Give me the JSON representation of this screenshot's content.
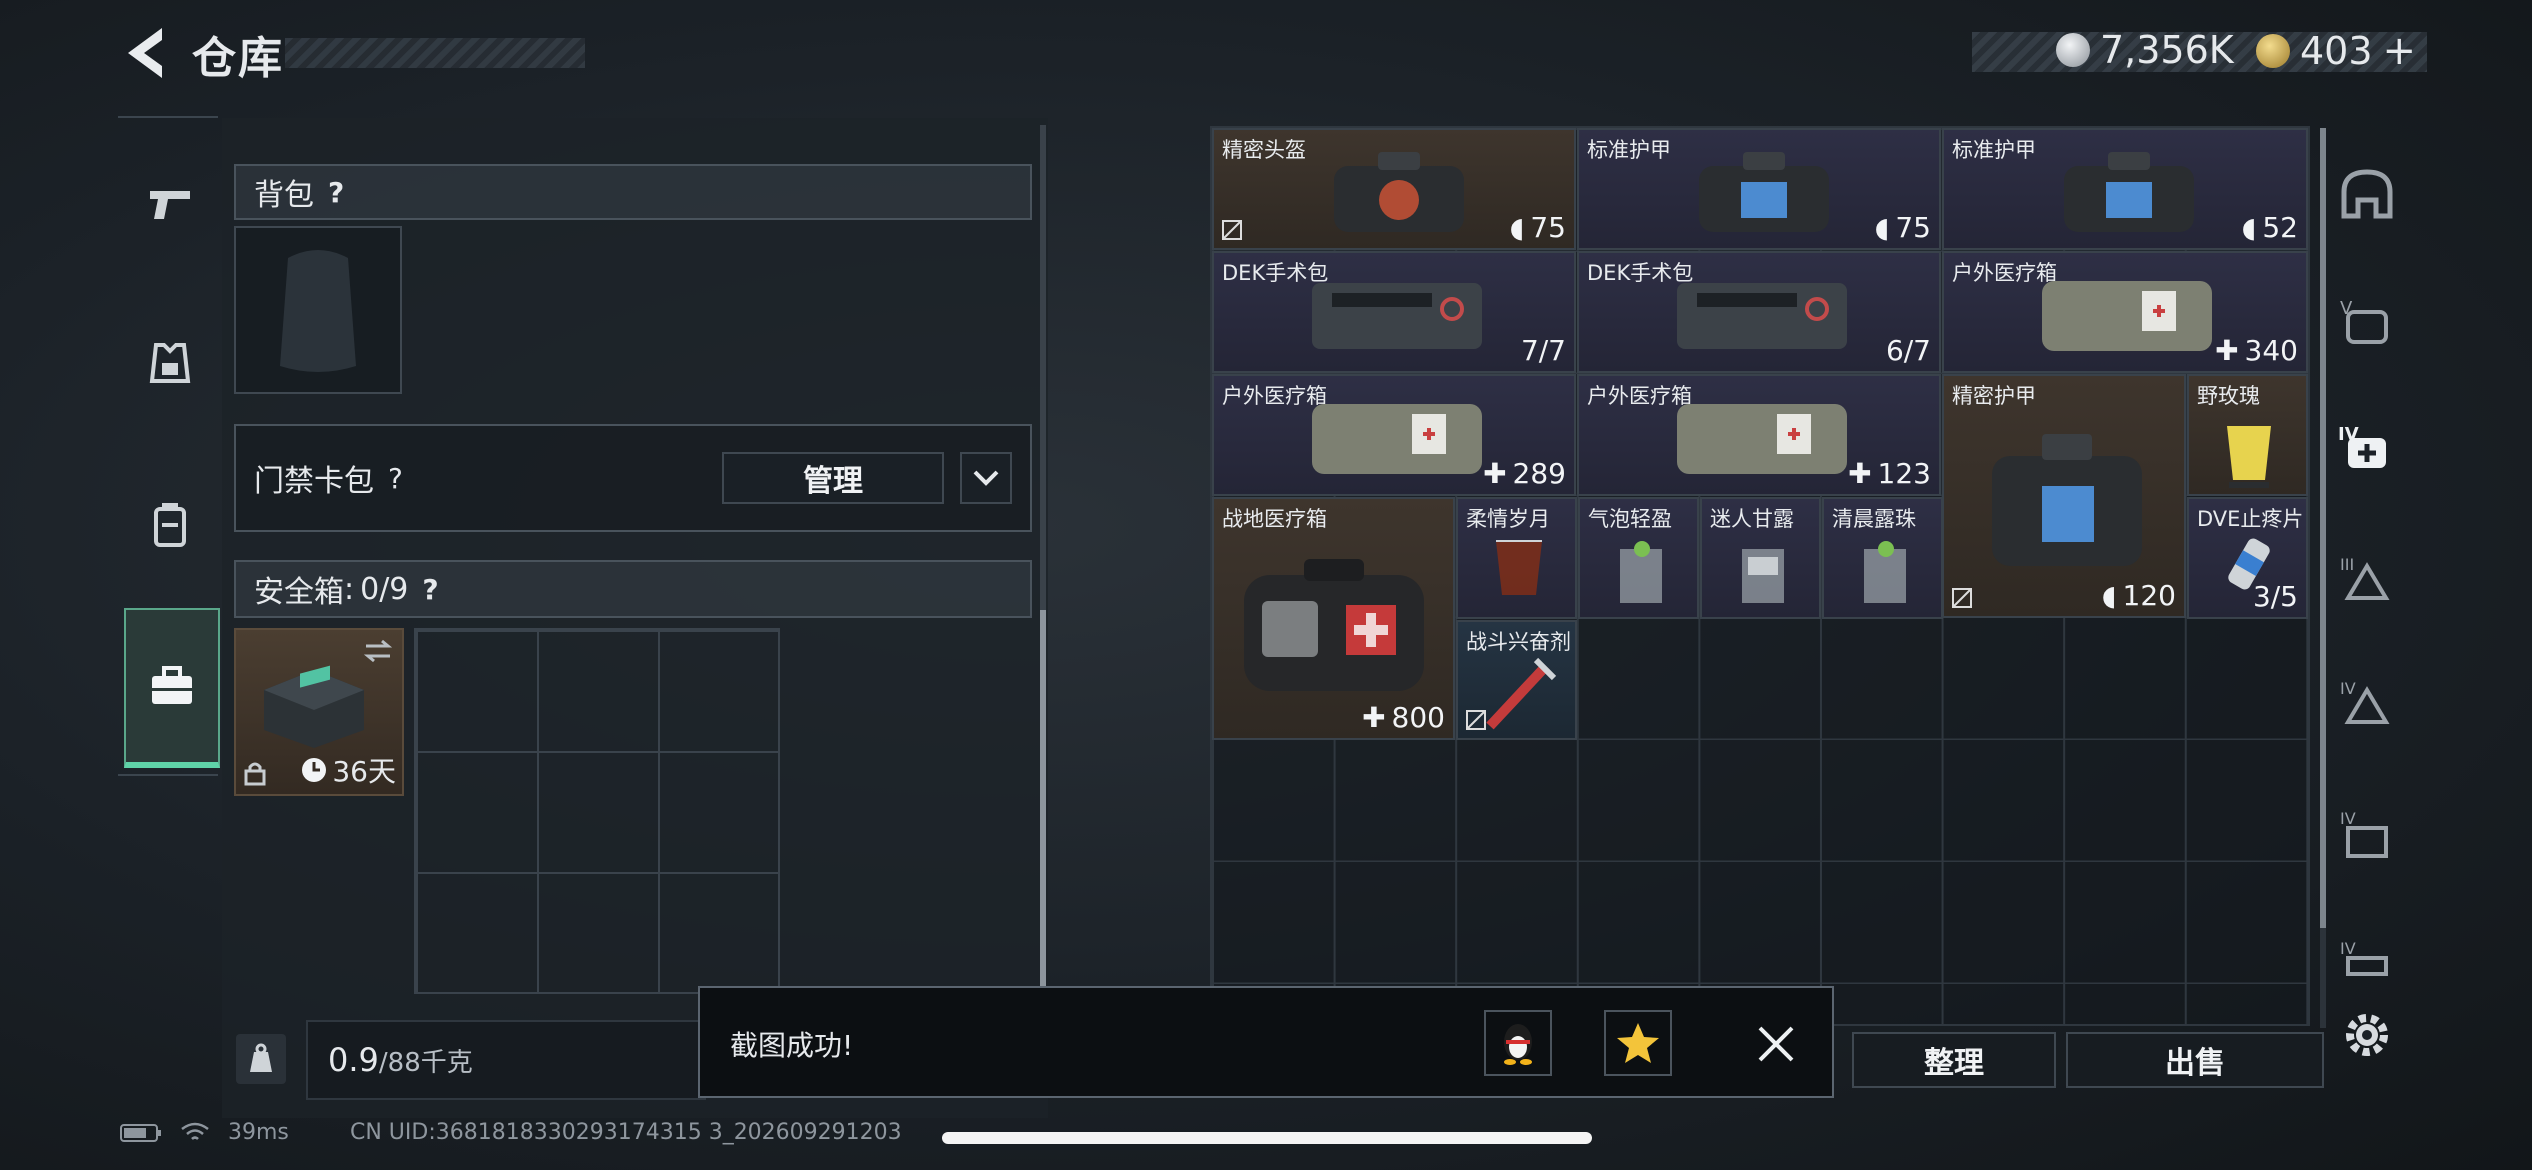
{
  "header": {
    "title": "仓库"
  },
  "currency": {
    "silver": "7,356K",
    "gold": "403"
  },
  "left_panel": {
    "backpack_label": "背包",
    "keycard_label": "门禁卡包",
    "manage_label": "管理",
    "safebox_label": "安全箱",
    "safebox_count": "0/9",
    "help": "?",
    "safebox_item_days": "36天"
  },
  "weight": {
    "current": "0.9",
    "max": "/88千克"
  },
  "items": [
    {
      "name": "精密头盔",
      "value": "75"
    },
    {
      "name": "标准护甲",
      "value": "75"
    },
    {
      "name": "标准护甲",
      "value": "52"
    },
    {
      "name": "DEK手术包",
      "value": "7/7"
    },
    {
      "name": "DEK手术包",
      "value": "6/7"
    },
    {
      "name": "户外医疗箱",
      "value": "340"
    },
    {
      "name": "户外医疗箱",
      "value": "289"
    },
    {
      "name": "户外医疗箱",
      "value": "123"
    },
    {
      "name": "精密护甲",
      "value": "120"
    },
    {
      "name": "野玫瑰",
      "value": ""
    },
    {
      "name": "战地医疗箱",
      "value": "800"
    },
    {
      "name": "柔情岁月",
      "value": ""
    },
    {
      "name": "气泡轻盈",
      "value": ""
    },
    {
      "name": "迷人甘露",
      "value": ""
    },
    {
      "name": "清晨露珠",
      "value": ""
    },
    {
      "name": "DVE止疼片",
      "value": "3/5"
    },
    {
      "name": "战斗兴奋剂",
      "value": ""
    }
  ],
  "actions": {
    "sort": "整理",
    "sell": "出售"
  },
  "toast": {
    "text": "截图成功!"
  },
  "status": {
    "ping": "39ms",
    "uid": "CN UID:3681818330293174315 3_202609291203"
  },
  "colors": {
    "accent_green": "#5fd3a8",
    "brown_tier": "#3e352d",
    "purple_tier": "#2e2f45"
  }
}
